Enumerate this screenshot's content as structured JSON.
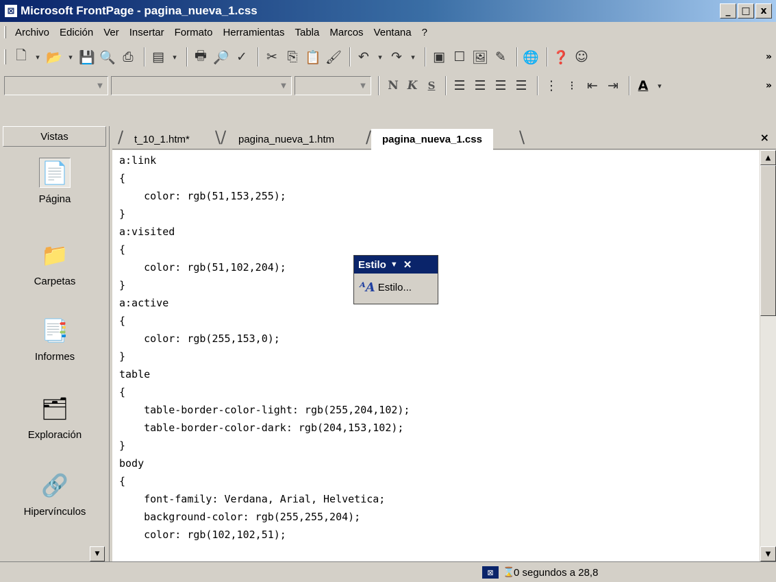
{
  "window": {
    "title": "Microsoft FrontPage - pagina_nueva_1.css",
    "app_icon": "frontpage-icon",
    "buttons": {
      "minimize": "_",
      "maximize": "□",
      "close": "x"
    }
  },
  "menu": {
    "items": [
      "Archivo",
      "Edición",
      "Ver",
      "Insertar",
      "Formato",
      "Herramientas",
      "Tabla",
      "Marcos",
      "Ventana",
      "?"
    ]
  },
  "toolbar": {
    "overflow": "»"
  },
  "formatting": {
    "style_value": "",
    "font_value": "",
    "size_value": "",
    "bold": "N",
    "italic": "K",
    "underline": "S",
    "overflow": "»"
  },
  "views": {
    "header": "Vistas",
    "items": [
      {
        "label": "Página",
        "icon": "page-view-icon"
      },
      {
        "label": "Carpetas",
        "icon": "folder-view-icon"
      },
      {
        "label": "Informes",
        "icon": "reports-view-icon"
      },
      {
        "label": "Exploración",
        "icon": "navigation-view-icon"
      },
      {
        "label": "Hipervínculos",
        "icon": "hyperlinks-view-icon"
      }
    ]
  },
  "tabs": [
    {
      "label": "t_10_1.htm*",
      "active": false
    },
    {
      "label": "pagina_nueva_1.htm",
      "active": false
    },
    {
      "label": "pagina_nueva_1.css",
      "active": true
    }
  ],
  "tab_close": "×",
  "code": [
    "a:link",
    "{",
    "    color: rgb(51,153,255);",
    "}",
    "a:visited",
    "{",
    "    color: rgb(51,102,204);",
    "}",
    "a:active",
    "{",
    "    color: rgb(255,153,0);",
    "}",
    "table",
    "{",
    "    table-border-color-light: rgb(255,204,102);",
    "    table-border-color-dark: rgb(204,153,102);",
    "}",
    "body",
    "{",
    "    font-family: Verdana, Arial, Helvetica;",
    "    background-color: rgb(255,255,204);",
    "    color: rgb(102,102,51);"
  ],
  "estilo_toolbar": {
    "title": "Estilo",
    "button_label": "Estilo..."
  },
  "status": {
    "text": "0 segundos a 28,8"
  }
}
